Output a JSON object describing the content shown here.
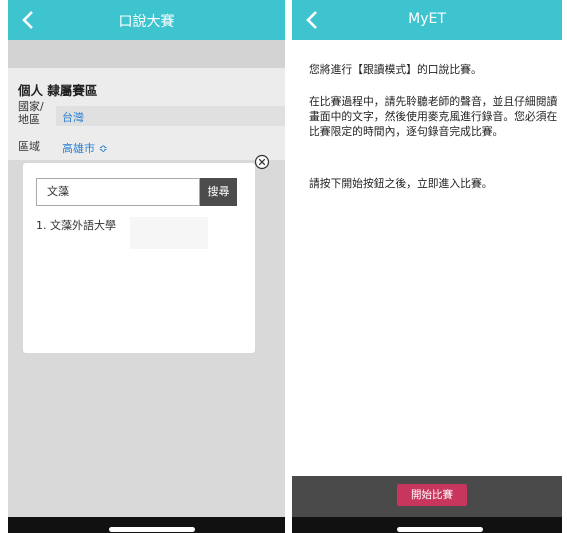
{
  "left": {
    "title": "口說大賽",
    "section_title": "個人 隸屬賽區",
    "country_label_line1": "國家/",
    "country_label_line2": "地區",
    "country_value": "台灣",
    "region_label": "區域",
    "region_value": "高雄市 ≎",
    "dialog": {
      "search_value": "文藻",
      "search_button": "搜尋",
      "result_item": "1. 文藻外語大學"
    }
  },
  "right": {
    "title": "MyET",
    "para1": "您將進行【跟讀模式】的口說比賽。",
    "para2": "在比賽過程中，請先聆聽老師的聲音，並且仔細閱讀畫面中的文字，然後使用麥克風進行錄音。您必須在比賽限定的時間內，逐句錄音完成比賽。",
    "para3": "請按下開始按鈕之後，立即進入比賽。",
    "start_button": "開始比賽"
  },
  "icons": {
    "back": "chevron-left-icon",
    "close": "circle-x-icon"
  },
  "colors": {
    "header": "#3ec4cf",
    "start_button": "#c8355d",
    "link_value": "#2a7fd0"
  }
}
